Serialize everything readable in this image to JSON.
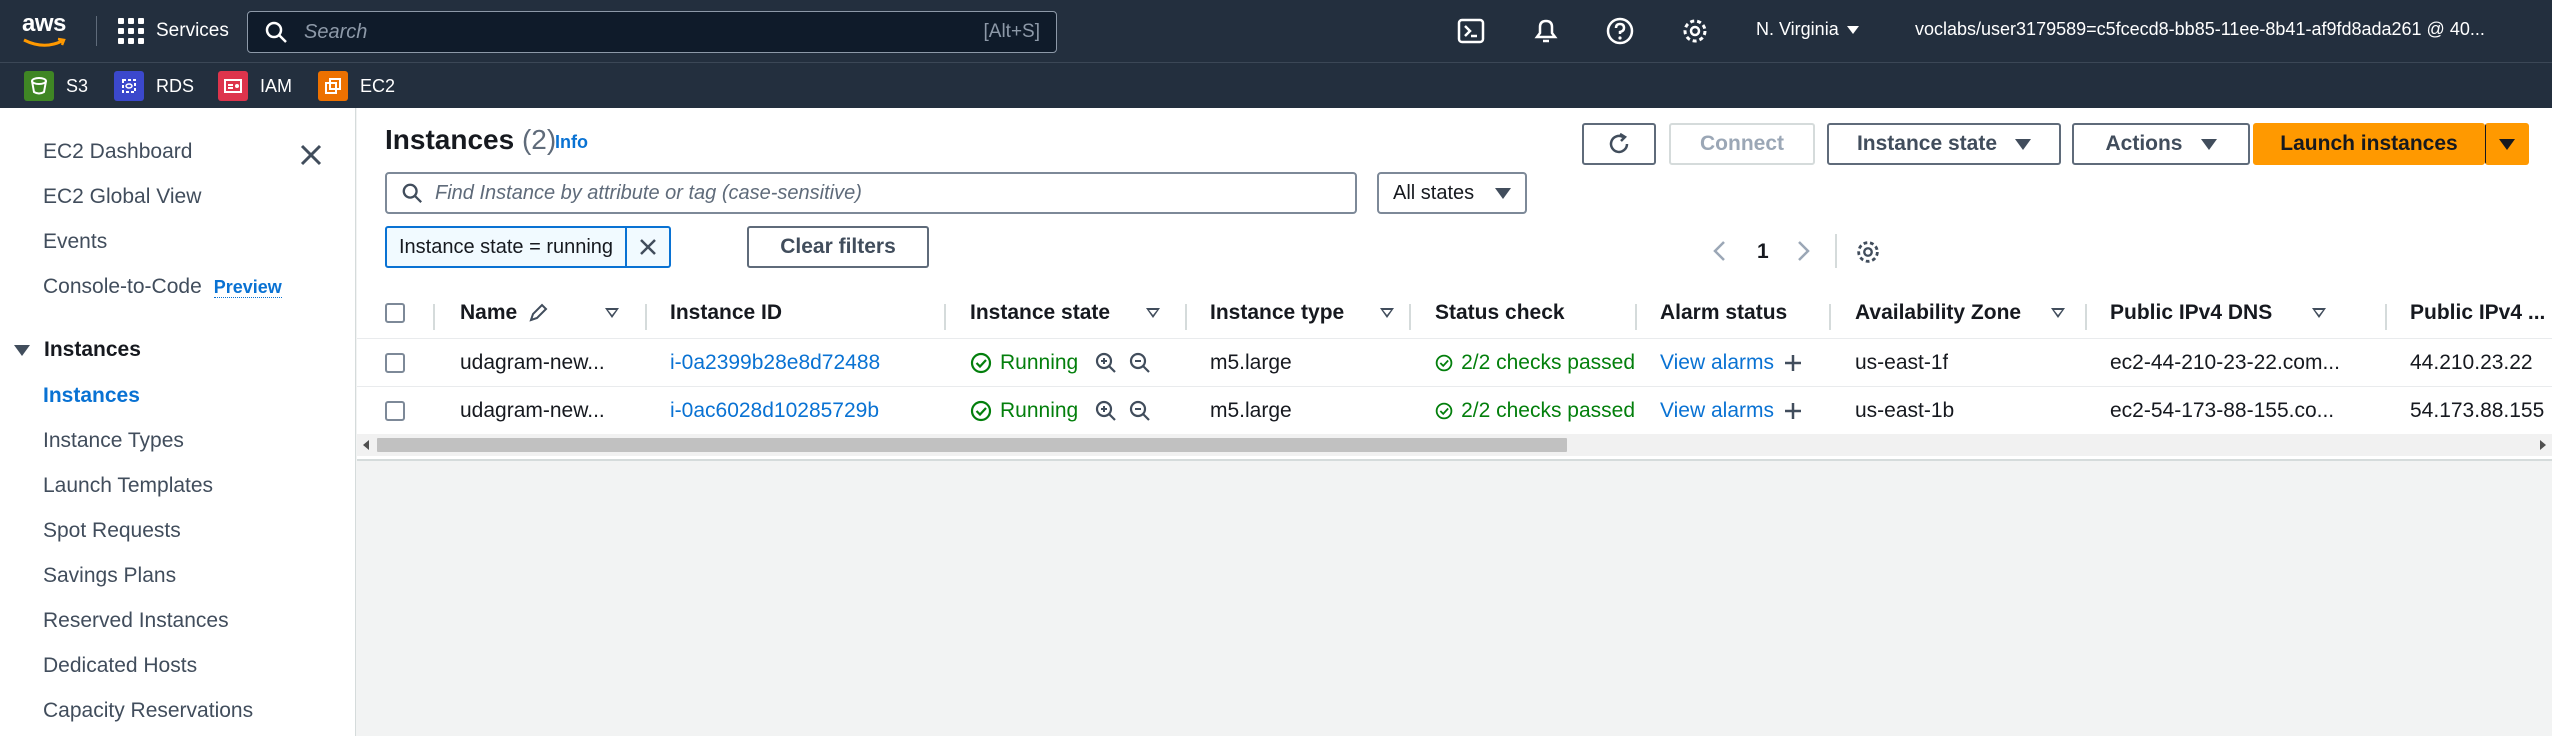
{
  "topnav": {
    "logo": "aws",
    "services_label": "Services",
    "search_placeholder": "Search",
    "search_shortcut": "[Alt+S]",
    "region": "N. Virginia",
    "account": "voclabs/user3179589=c5fcecd8-bb85-11ee-8b41-af9fd8ada261 @ 40...",
    "icons": [
      "cloudshell-icon",
      "bell-icon",
      "help-icon",
      "gear-icon"
    ]
  },
  "favorites": [
    {
      "label": "S3",
      "color": "#3f8624"
    },
    {
      "label": "RDS",
      "color": "#3b48cc"
    },
    {
      "label": "IAM",
      "color": "#dd344c"
    },
    {
      "label": "EC2",
      "color": "#ed7100"
    }
  ],
  "sidebar": {
    "items_top": [
      "EC2 Dashboard",
      "EC2 Global View",
      "Events",
      "Console-to-Code"
    ],
    "preview_badge": "Preview",
    "section_instances": "Instances",
    "items_instances": [
      "Instances",
      "Instance Types",
      "Launch Templates",
      "Spot Requests",
      "Savings Plans",
      "Reserved Instances",
      "Dedicated Hosts",
      "Capacity Reservations"
    ],
    "active": "Instances"
  },
  "main": {
    "title": "Instances",
    "count": "(2)",
    "info": "Info",
    "buttons": {
      "connect": "Connect",
      "instance_state": "Instance state",
      "actions": "Actions",
      "launch": "Launch instances"
    },
    "filter_placeholder": "Find Instance by attribute or tag (case-sensitive)",
    "states_select": "All states",
    "token": "Instance state = running",
    "clear_filters": "Clear filters",
    "page": "1"
  },
  "table": {
    "headers": [
      "Name",
      "Instance ID",
      "Instance state",
      "Instance type",
      "Status check",
      "Alarm status",
      "Availability Zone",
      "Public IPv4 DNS",
      "Public IPv4 ..."
    ],
    "rows": [
      {
        "name": "udagram-new...",
        "id": "i-0a2399b28e8d72488",
        "state": "Running",
        "type": "m5.large",
        "status": "2/2 checks passed",
        "alarm": "View alarms",
        "az": "us-east-1f",
        "dns": "ec2-44-210-23-22.com...",
        "ip": "44.210.23.22"
      },
      {
        "name": "udagram-new...",
        "id": "i-0ac6028d10285729b",
        "state": "Running",
        "type": "m5.large",
        "status": "2/2 checks passed",
        "alarm": "View alarms",
        "az": "us-east-1b",
        "dns": "ec2-54-173-88-155.co...",
        "ip": "54.173.88.155"
      }
    ]
  },
  "colors": {
    "nav_bg": "#232f3e",
    "link": "#0972d3",
    "success": "#037f0c",
    "primary": "#ff9900"
  }
}
